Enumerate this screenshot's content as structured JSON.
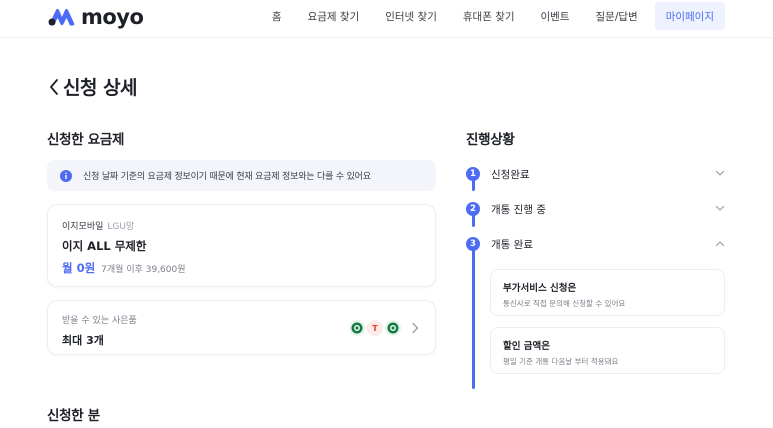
{
  "header": {
    "logo_text": "moyo",
    "nav": [
      {
        "label": "홈"
      },
      {
        "label": "요금제 찾기"
      },
      {
        "label": "인터넷 찾기"
      },
      {
        "label": "휴대폰 찾기"
      },
      {
        "label": "이벤트"
      },
      {
        "label": "질문/답변"
      },
      {
        "label": "마이페이지"
      }
    ]
  },
  "page": {
    "title": "신청 상세"
  },
  "plan_section": {
    "title": "신청한 요금제",
    "notice": "신청 날짜 기준의 요금제 정보이기 때문에 현재 요금제 정보와는 다를 수 있어요",
    "plan": {
      "carrier": "이지모바일",
      "network": "LGU망",
      "name": "이지 ALL 무제한",
      "price": "월 0원",
      "after_price": "7개월 이후 39,600원"
    },
    "gift": {
      "label": "받을 수 있는 사은품",
      "value": "최대 3개",
      "icon_t": "T"
    }
  },
  "applicant_section": {
    "title": "신청한 분"
  },
  "progress": {
    "title": "진행상황",
    "steps": [
      {
        "num": "1",
        "label": "신청완료"
      },
      {
        "num": "2",
        "label": "개통 진행 중"
      },
      {
        "num": "3",
        "label": "개통 완료"
      }
    ],
    "details": [
      {
        "title": "부가서비스 신청은",
        "desc": "통신사로 직접 문의해 신청할 수 있어요"
      },
      {
        "title": "할인 금액은",
        "desc": "평일 기준 개통 다음날 부터 적용돼요"
      }
    ]
  },
  "colors": {
    "accent": "#4d6cf3",
    "info_bg": "#f3f5fa",
    "nav_active_bg": "#eef1fe"
  }
}
